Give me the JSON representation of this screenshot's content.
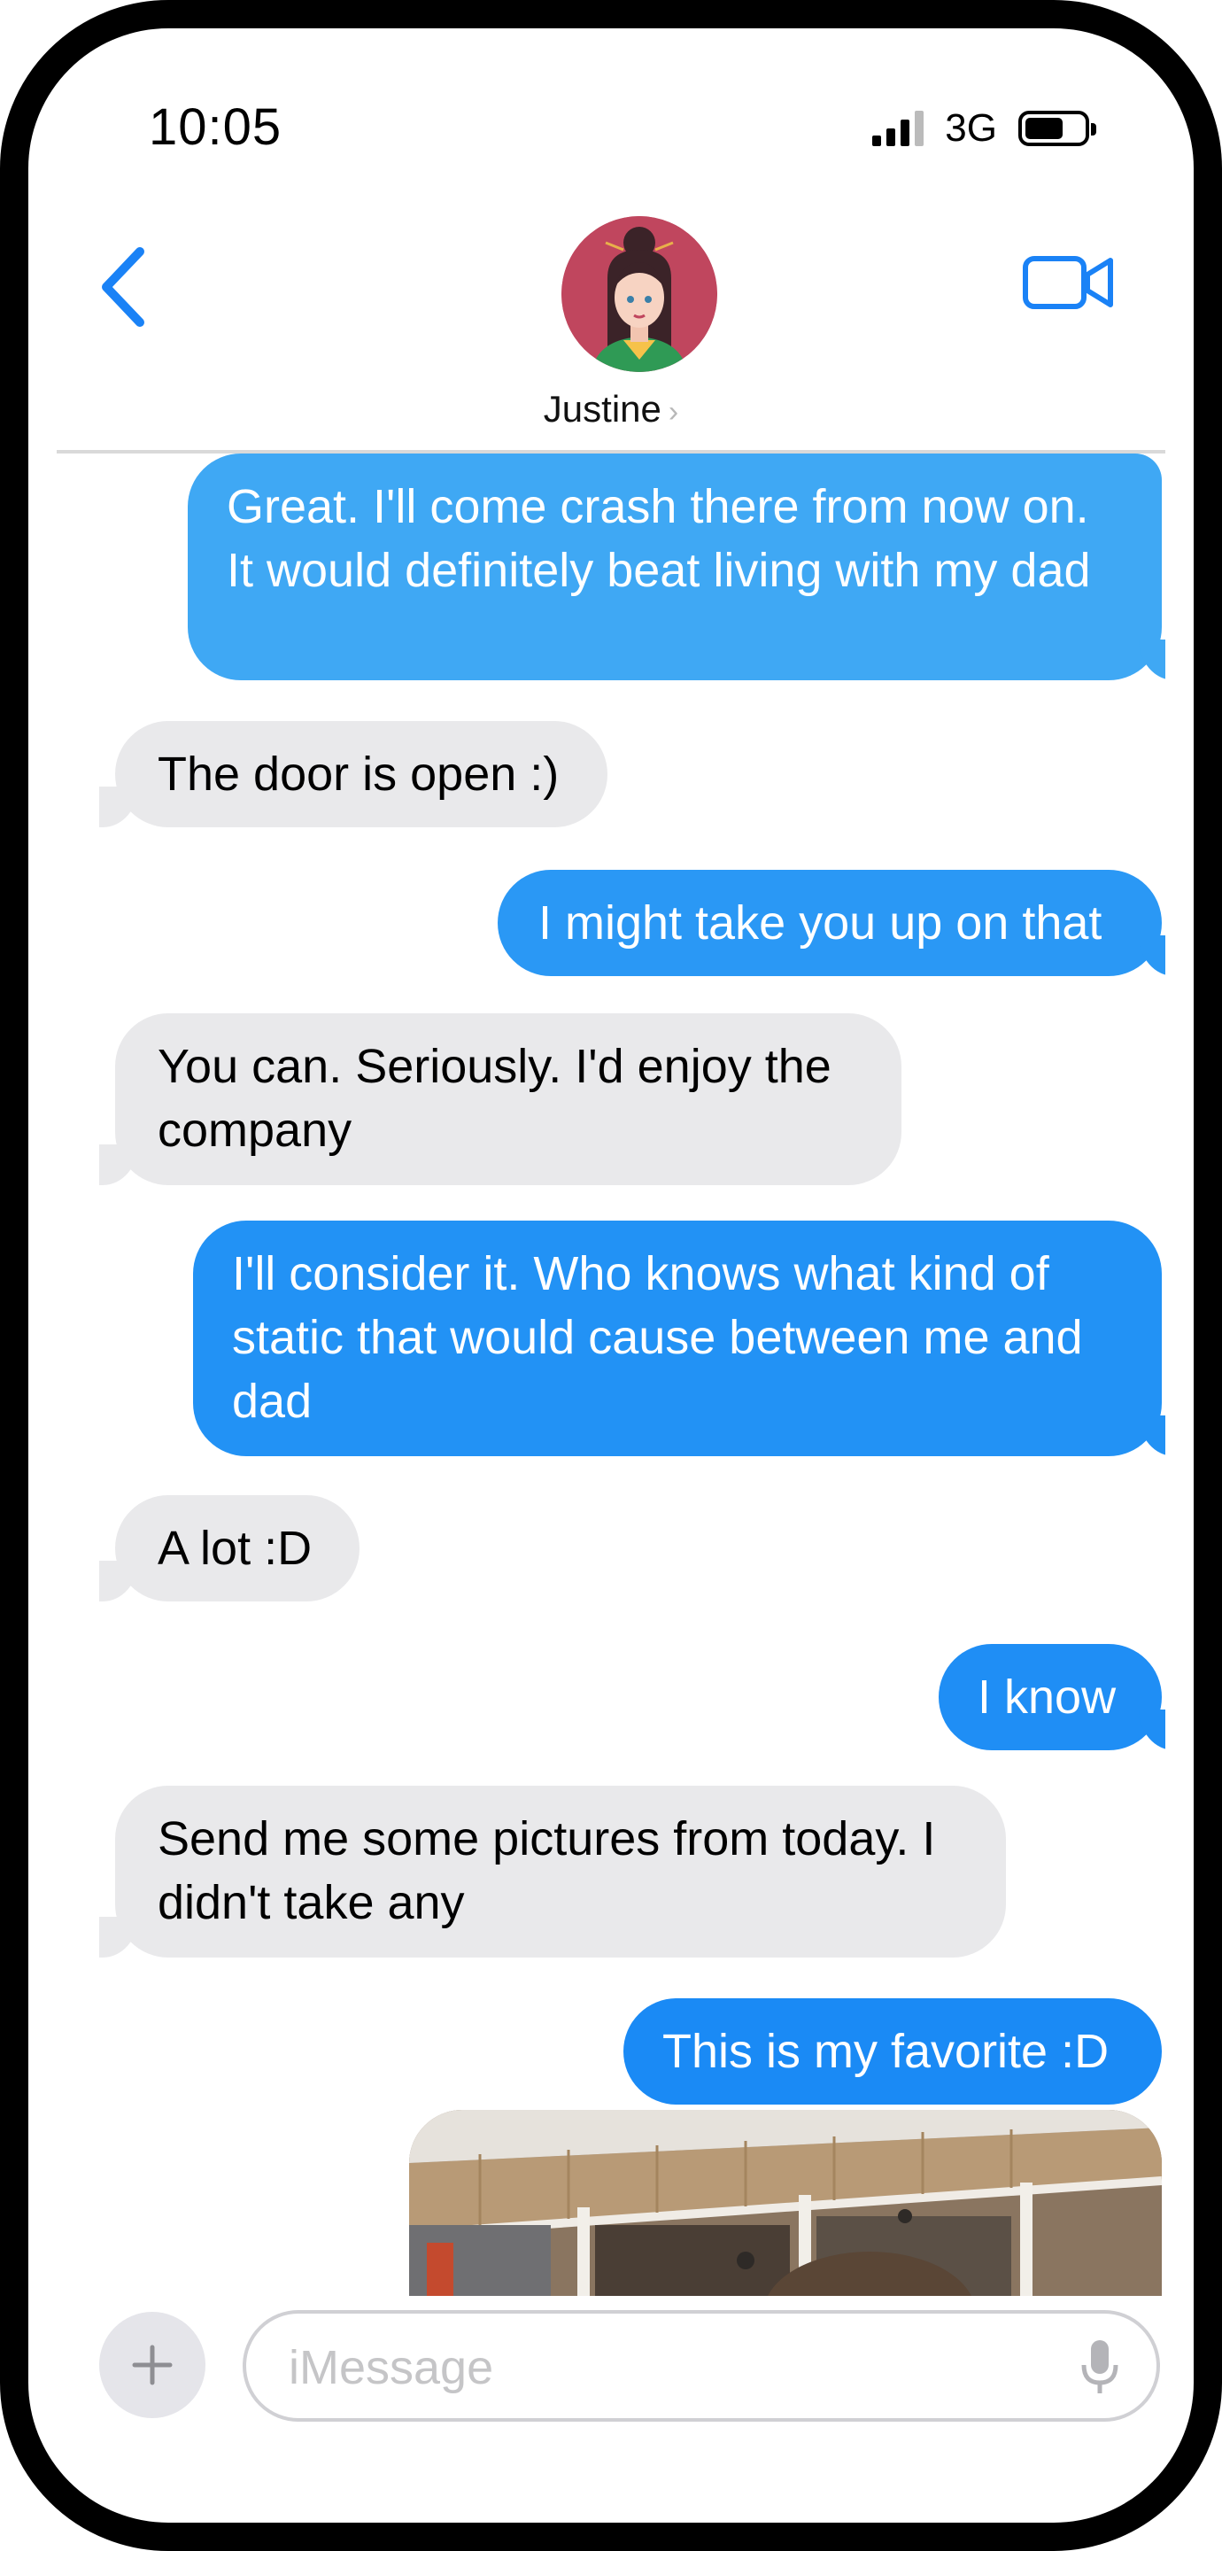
{
  "status_bar": {
    "time": "10:05",
    "network": "3G",
    "icons": [
      "signal-bars-icon",
      "battery-icon"
    ]
  },
  "header": {
    "contact_name": "Justine",
    "icons": [
      "back-chevron-icon",
      "video-camera-icon",
      "chevron-right-icon"
    ]
  },
  "colors": {
    "accent": "#1a82f6",
    "outgoing_bubble_light": "#3fa8f4",
    "outgoing_bubble": "#1f8ef5",
    "incoming_bubble": "#e9e9eb",
    "avatar_bg": "#c0465e"
  },
  "messages": [
    {
      "direction": "outgoing",
      "text": "Great.  I'll come crash there from now on. It would definitely beat living with my dad"
    },
    {
      "direction": "incoming",
      "text": "The door is open :)"
    },
    {
      "direction": "outgoing",
      "text": "I might take you up on that"
    },
    {
      "direction": "incoming",
      "text": "You can.  Seriously.  I'd enjoy the company"
    },
    {
      "direction": "outgoing",
      "text": "I'll consider it.  Who knows what kind of static that would cause between me and dad"
    },
    {
      "direction": "incoming",
      "text": "A lot :D"
    },
    {
      "direction": "outgoing",
      "text": "I know"
    },
    {
      "direction": "incoming",
      "text": "Send me some pictures from today.  I didn't take any"
    },
    {
      "direction": "outgoing",
      "text": "This is my favorite :D"
    }
  ],
  "composer": {
    "placeholder": "iMessage",
    "value": "",
    "icons": [
      "plus-icon",
      "microphone-icon"
    ]
  }
}
